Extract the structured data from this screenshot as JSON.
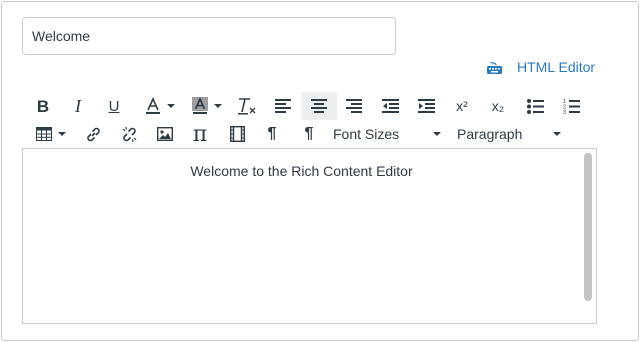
{
  "title_field": {
    "value": "Welcome"
  },
  "html_editor": {
    "label": "HTML Editor",
    "icon": "keyboard-icon"
  },
  "toolbar": {
    "font_sizes_label": "Font Sizes",
    "paragraph_label": "Paragraph",
    "superscript_glyph": "x²",
    "subscript_glyph": "x₂",
    "pi_glyph": "π",
    "pilcrow_glyph": "¶"
  },
  "editor": {
    "content": "Welcome to the Rich Content Editor"
  },
  "colors": {
    "accent": "#2b7abc",
    "text": "#2d3b45",
    "border": "#c7cdd1",
    "active_bg": "#eceeef"
  }
}
